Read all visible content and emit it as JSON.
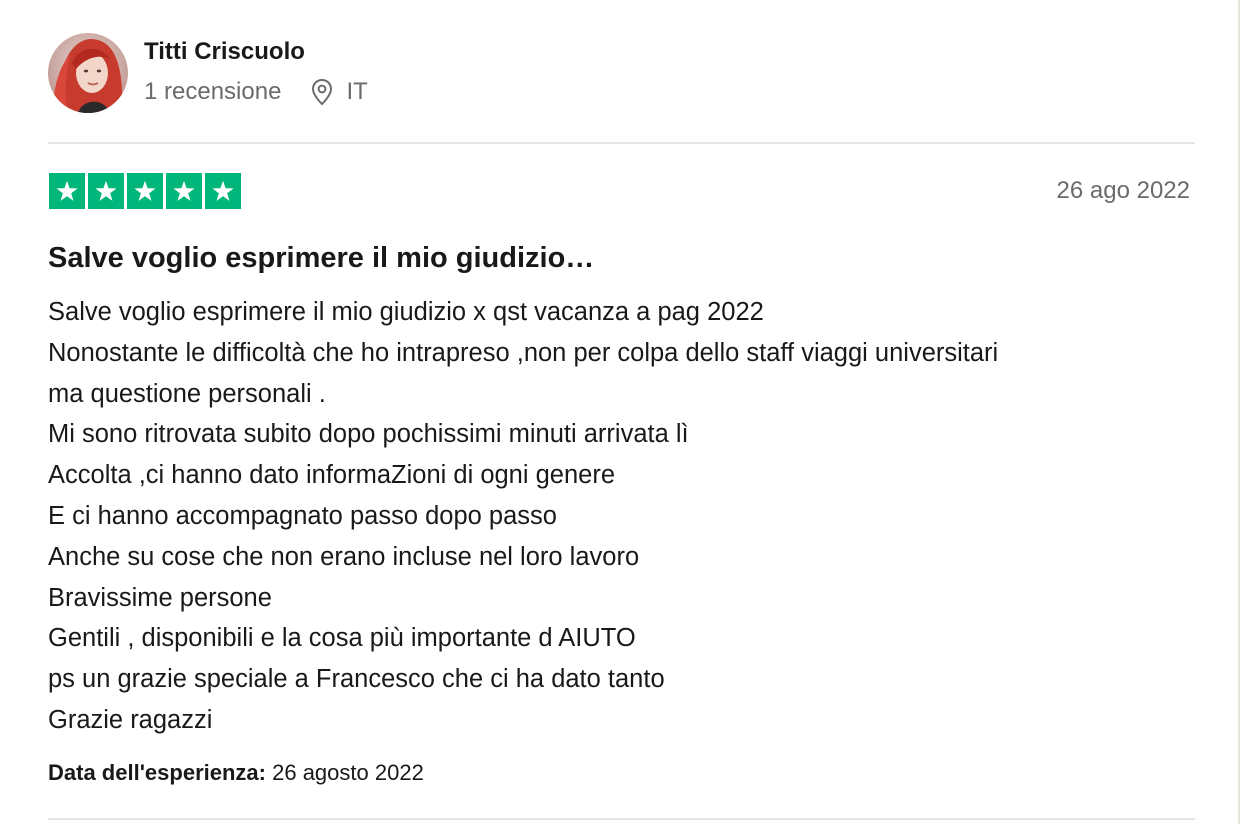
{
  "reviewer": {
    "name": "Titti Criscuolo",
    "reviews_count": "1 recensione",
    "country": "IT"
  },
  "rating": {
    "stars": 5,
    "max": 5,
    "color": "#00b67a"
  },
  "review": {
    "date": "26 ago 2022",
    "title": "Salve voglio esprimere il mio giudizio…",
    "body_lines": [
      "Salve voglio esprimere il mio giudizio x qst vacanza a pag 2022",
      "Nonostante le difficoltà che ho intrapreso ,non per colpa dello staff viaggi universitari",
      "ma questione personali .",
      "Mi sono ritrovata subito dopo pochissimi minuti arrivata lì",
      "Accolta ,ci hanno dato informaZioni di ogni genere",
      "E ci hanno accompagnato passo dopo passo",
      "Anche su cose che non erano incluse nel loro lavoro",
      "Bravissime persone",
      "Gentili , disponibili e la cosa più importante d AIUTO",
      "ps un grazie speciale a Francesco che ci ha dato tanto",
      "Grazie ragazzi"
    ],
    "experience_label": "Data dell'esperienza:",
    "experience_date": "26 agosto 2022"
  },
  "icons": {
    "location": "location-pin-icon",
    "star": "star-icon"
  }
}
